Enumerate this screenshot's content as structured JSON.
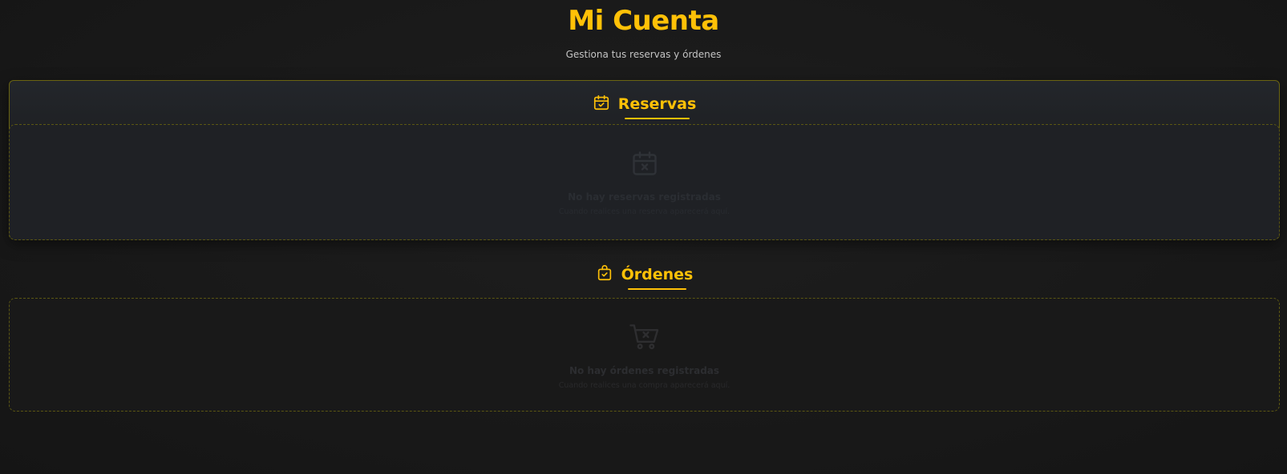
{
  "header": {
    "title": "Mi Cuenta",
    "subtitle": "Gestiona tus reservas y órdenes"
  },
  "reservas": {
    "title": "Reservas",
    "icon": "calendar-check-icon",
    "empty": {
      "icon": "calendar-x-icon",
      "title": "No hay reservas registradas",
      "text": "Cuando realices una reserva aparecerá aquí."
    }
  },
  "ordenes": {
    "title": "Órdenes",
    "icon": "shopping-bag-check-icon",
    "empty": {
      "icon": "cart-x-icon",
      "title": "No hay órdenes registradas",
      "text": "Cuando realices una compra aparecerá aquí."
    }
  },
  "colors": {
    "accent": "#ffc107",
    "background": "#191919",
    "panel": "#202226",
    "border": "#6a6412"
  }
}
